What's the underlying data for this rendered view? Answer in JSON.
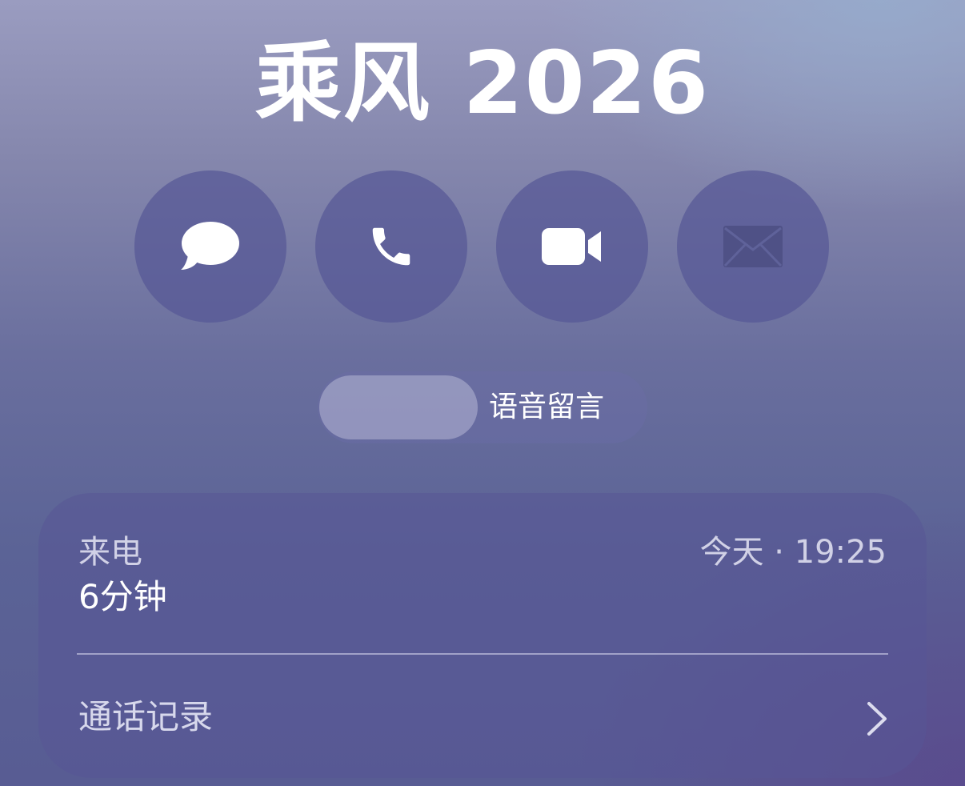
{
  "contact": {
    "name": "乘风 2026"
  },
  "actions": [
    {
      "id": "message",
      "icon": "message-bubble-icon"
    },
    {
      "id": "call",
      "icon": "phone-icon"
    },
    {
      "id": "video",
      "icon": "video-camera-icon"
    },
    {
      "id": "mail",
      "icon": "envelope-icon"
    }
  ],
  "segmented": {
    "right_label": "语音留言"
  },
  "call_info": {
    "type": "来电",
    "duration": "6分钟",
    "time": "今天 · 19:25"
  },
  "history": {
    "label": "通话记录",
    "icon": "chevron-right-icon"
  },
  "colors": {
    "button_bg": "#5a5c96",
    "mail_icon": "#4f5186",
    "text": "#ffffff"
  }
}
